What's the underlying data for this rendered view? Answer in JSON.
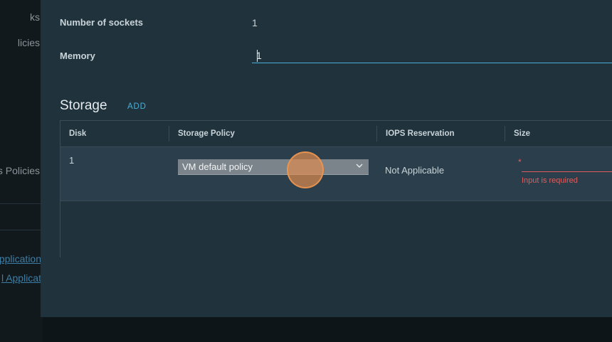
{
  "background": {
    "sidebar_items": [
      "ks",
      "licies",
      "s Policies"
    ],
    "links": [
      "pplication",
      "l Applicat"
    ]
  },
  "compute": {
    "sockets_label": "Number of sockets",
    "sockets_value": "1",
    "memory_label": "Memory",
    "memory_value": "1"
  },
  "storage": {
    "title": "Storage",
    "add_label": "ADD",
    "columns": [
      "Disk",
      "Storage Policy",
      "IOPS Reservation",
      "Size"
    ],
    "rows": [
      {
        "disk": "1",
        "policy": "VM default policy",
        "iops": "Not Applicable",
        "size_required_marker": "*",
        "size_value": "",
        "size_error": "Input is required"
      }
    ]
  },
  "colors": {
    "accent": "#49afd9",
    "error": "#e05c5c",
    "modal_bg": "#20333d",
    "click_indicator": "#de8c50"
  },
  "icons": [
    "chevron-down-icon"
  ]
}
